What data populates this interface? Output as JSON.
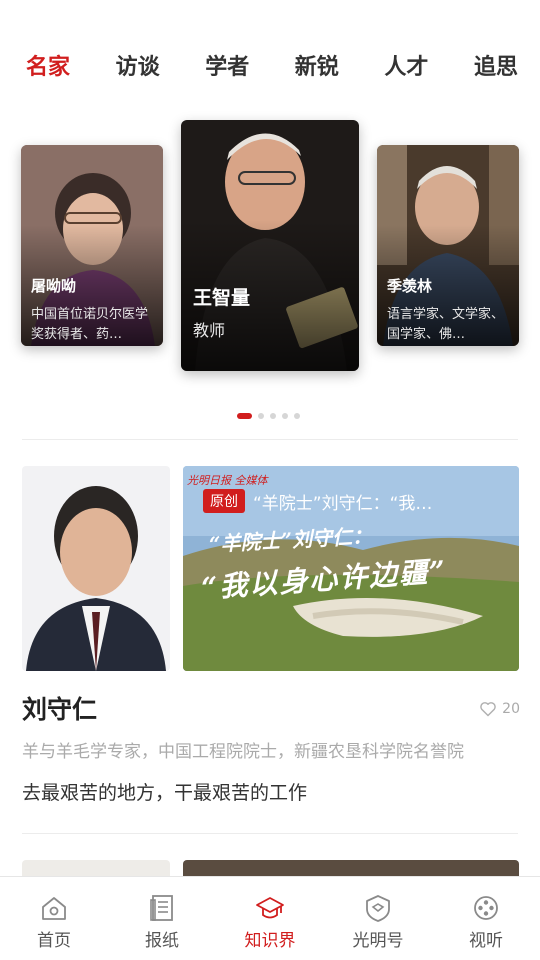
{
  "tabs": [
    {
      "label": "名家",
      "active": true
    },
    {
      "label": "访谈",
      "active": false
    },
    {
      "label": "学者",
      "active": false
    },
    {
      "label": "新锐",
      "active": false
    },
    {
      "label": "人才",
      "active": false
    },
    {
      "label": "追思",
      "active": false
    }
  ],
  "carousel": {
    "cards": [
      {
        "name": "屠呦呦",
        "desc": "中国首位诺贝尔医学奖获得者、药…"
      },
      {
        "name": "王智量",
        "desc": "教师"
      },
      {
        "name": "季羡林",
        "desc": "语言学家、文学家、国学家、佛…"
      }
    ],
    "dots_total": 5,
    "active_dot": 0
  },
  "feature": {
    "badge": "原创",
    "headline": "“羊院士”刘守仁：“我…",
    "banner_brand": "光明日报 全媒体",
    "banner_line1": "“羊院士”刘守仁：",
    "banner_line2": "“我以身心许边疆”",
    "person_name": "刘守仁",
    "likes": "20",
    "subtitle": "羊与羊毛学专家，中国工程院院士，新疆农垦科学院名誉院",
    "quote": "去最艰苦的地方，干最艰苦的工作"
  },
  "bottom_nav": [
    {
      "label": "首页",
      "icon": "home-icon",
      "active": false
    },
    {
      "label": "报纸",
      "icon": "newspaper-icon",
      "active": false
    },
    {
      "label": "知识界",
      "icon": "graduation-cap-icon",
      "active": true
    },
    {
      "label": "光明号",
      "icon": "shield-icon",
      "active": false
    },
    {
      "label": "视听",
      "icon": "film-reel-icon",
      "active": false
    }
  ],
  "colors": {
    "accent": "#d11e1e",
    "muted": "#aaaaaa",
    "text": "#222222"
  }
}
